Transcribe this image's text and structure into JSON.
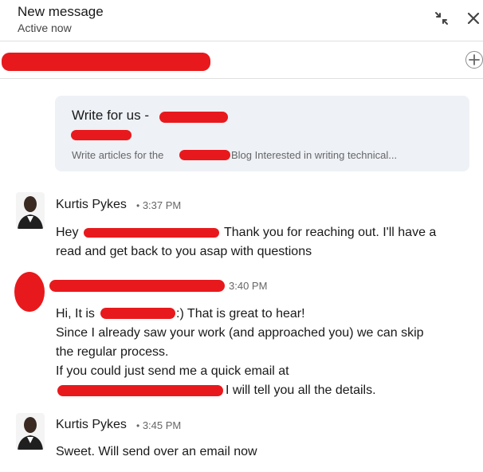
{
  "header": {
    "title": "New message",
    "status": "Active now",
    "minimize_icon": "minimize-arrows-icon",
    "close_icon": "close-icon"
  },
  "recipient": {
    "add_icon": "plus-icon"
  },
  "link_preview": {
    "title": "Write for us -",
    "description_prefix": "Write articles for the",
    "description_suffix": "Blog Interested in writing technical..."
  },
  "messages": [
    {
      "sender": "Kurtis Pykes",
      "separator": "•",
      "time": "3:37 PM",
      "lines": [
        [
          "Hey",
          "Thank you for reaching out. I'll have a"
        ],
        [
          "read and get back to you asap with questions"
        ]
      ]
    },
    {
      "sender": "",
      "time": "3:40 PM",
      "lines": [
        [
          "Hi, It is",
          ":) That is great to hear!"
        ],
        [
          "Since I already saw your work (and approached you) we can skip"
        ],
        [
          "the regular process."
        ],
        [
          "If you could just send me a quick email at"
        ],
        [
          "I will tell you all the details."
        ]
      ]
    },
    {
      "sender": "Kurtis Pykes",
      "separator": "•",
      "time": "3:45 PM",
      "lines": [
        [
          "Sweet. Will send over an email now"
        ]
      ]
    }
  ],
  "colors": {
    "redaction": "#e8191c",
    "card_bg": "#eef1f6",
    "border": "#e0e0e0"
  }
}
